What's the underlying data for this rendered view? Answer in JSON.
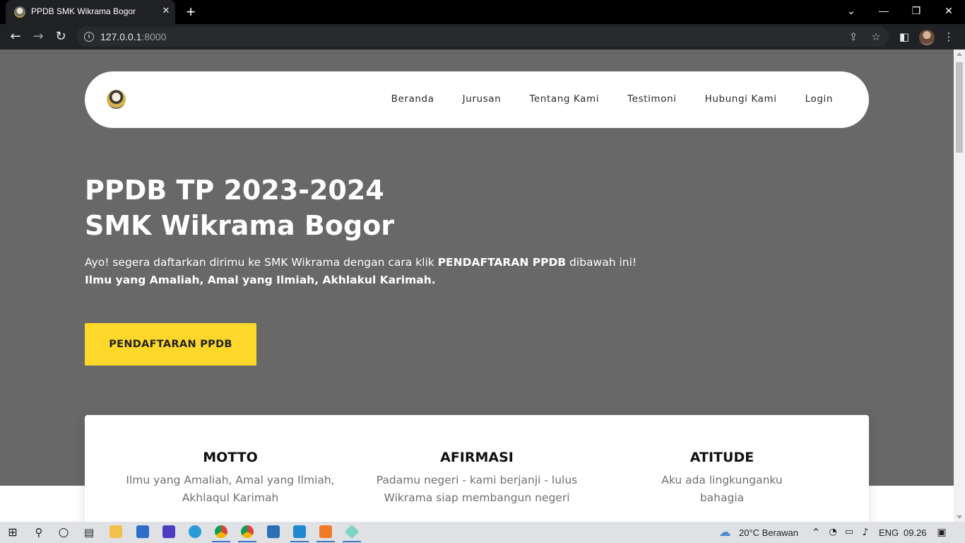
{
  "browser": {
    "tab_title": "PPDB SMK Wikrama Bogor",
    "tab_close": "✕",
    "new_tab": "+",
    "url_host": "127.0.0.1",
    "url_port": ":8000",
    "window_controls": {
      "tabs_dropdown": "⌄",
      "minimize": "—",
      "restore": "❐",
      "close": "✕"
    }
  },
  "navbar": {
    "items": [
      "Beranda",
      "Jurusan",
      "Tentang Kami",
      "Testimoni",
      "Hubungi Kami",
      "Login"
    ]
  },
  "hero": {
    "title_line1": "PPDB TP 2023-2024",
    "title_line2": "SMK Wikrama Bogor",
    "desc_prefix": "Ayo! segera daftarkan dirimu ke SMK Wikrama dengan cara klik ",
    "desc_bold": "PENDAFTARAN PPDB",
    "desc_suffix": " dibawah ini!",
    "tagline": "Ilmu yang Amaliah, Amal yang Ilmiah, Akhlakul Karimah.",
    "cta_label": "PENDAFTARAN PPDB"
  },
  "values": [
    {
      "title": "MOTTO",
      "line1": "Ilmu yang Amaliah, Amal yang Ilmiah,",
      "line2": "Akhlaqul Karimah"
    },
    {
      "title": "AFIRMASI",
      "line1": "Padamu negeri - kami berjanji - lulus",
      "line2": "Wikrama siap membangun negeri"
    },
    {
      "title": "ATITUDE",
      "line1": "Aku ada lingkunganku",
      "line2": "bahagia"
    }
  ],
  "taskbar": {
    "weather": "20°C  Berawan",
    "language": "ENG",
    "time": "09.26"
  },
  "colors": {
    "hero_bg": "#686868",
    "cta_bg": "#fdd82a",
    "navbar_bg": "#ffffff",
    "browser_bg": "#202124"
  }
}
